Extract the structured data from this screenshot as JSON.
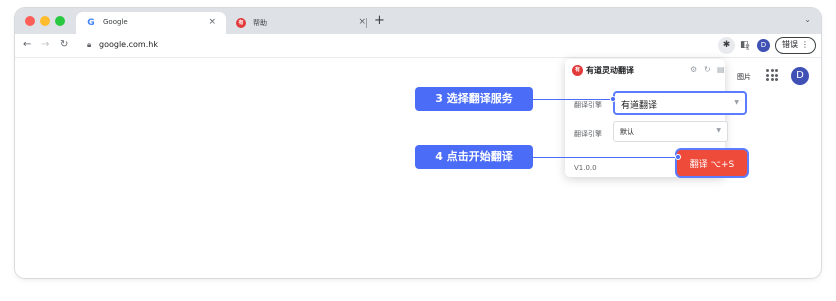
{
  "browser": {
    "tabs": [
      {
        "label": "Google",
        "favicon": "G",
        "active": true
      },
      {
        "label": "帮助",
        "favicon": "有",
        "active": false
      }
    ],
    "new_tab_icon": "+",
    "tab_close_icon": "×",
    "url": "google.com.hk",
    "profile_initial": "D",
    "error_pill_label": "错误"
  },
  "page": {
    "images_link_partial": "图片",
    "avatar_initial": "D"
  },
  "extension_popup": {
    "logo_text": "有",
    "title": "有道灵动翻译",
    "rows": [
      {
        "label": "翻译引擎",
        "value": "有道翻译"
      },
      {
        "label": "翻译引擎",
        "value": "默认"
      }
    ],
    "version": "V1.0.0",
    "translate_button_label": "翻译  ⌥+S"
  },
  "annotations": {
    "step3": "3 选择翻译服务",
    "step4": "4 点击开始翻译"
  },
  "colors": {
    "accent_blue": "#4a6cf7",
    "translate_red": "#ee4b3b",
    "brand_red": "#e23b3b"
  }
}
